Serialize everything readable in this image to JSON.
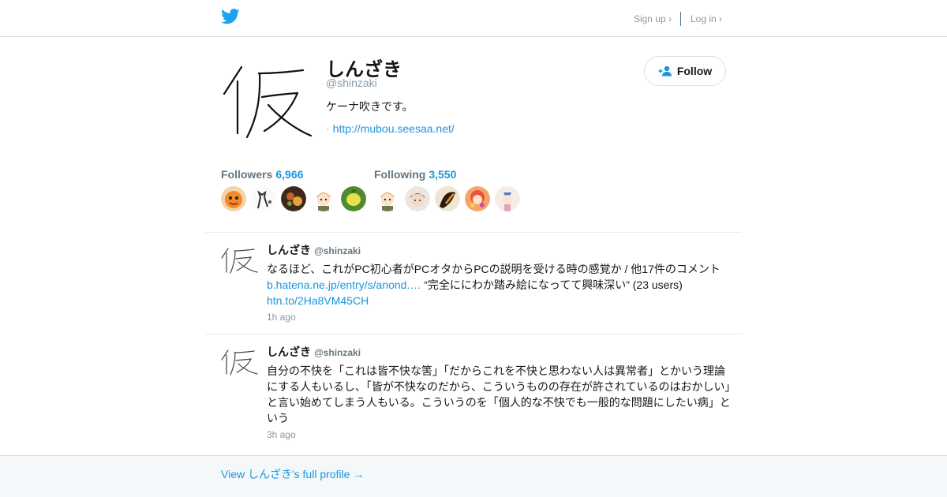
{
  "nav": {
    "signup": "Sign up ›",
    "login": "Log in ›"
  },
  "profile": {
    "name": "しんざき",
    "handle": "@shinzaki",
    "bio": "ケーナ吹きです。",
    "url_prefix": "·",
    "url": "http://mubou.seesaa.net/",
    "follow_label": "Follow",
    "avatar_glyph": "仮"
  },
  "stats": {
    "followers_label": "Followers",
    "followers_count": "6,966",
    "following_label": "Following",
    "following_count": "3,550"
  },
  "tweets": [
    {
      "name": "しんざき",
      "handle": "@shinzaki",
      "text_1": "なるほど、これがPC初心者がPCオタからPCの説明を受ける時の感覚か / 他17件のコメント",
      "link_1": "b.hatena.ne.jp/entry/s/anond.…",
      "text_2": " “完全ににわか踏み絵になってて興味深い” (23 users)",
      "link_2": "htn.to/2Ha8VM45CH",
      "time": "1h ago"
    },
    {
      "name": "しんざき",
      "handle": "@shinzaki",
      "text": "自分の不快を「これは皆不快な筈」「だからこれを不快と思わない人は異常者」とかいう理論にする人もいるし、「皆が不快なのだから、こういうものの存在が許されているのはおかしい」と言い始めてしまう人もいる。こういうのを「個人的な不快でも一般的な問題にしたい病」という",
      "time": "3h ago"
    }
  ],
  "footer": {
    "full_profile": "View しんざき's full profile →"
  },
  "colors": {
    "twitter_blue": "#1da1f2",
    "link_blue": "#1b95e0"
  }
}
